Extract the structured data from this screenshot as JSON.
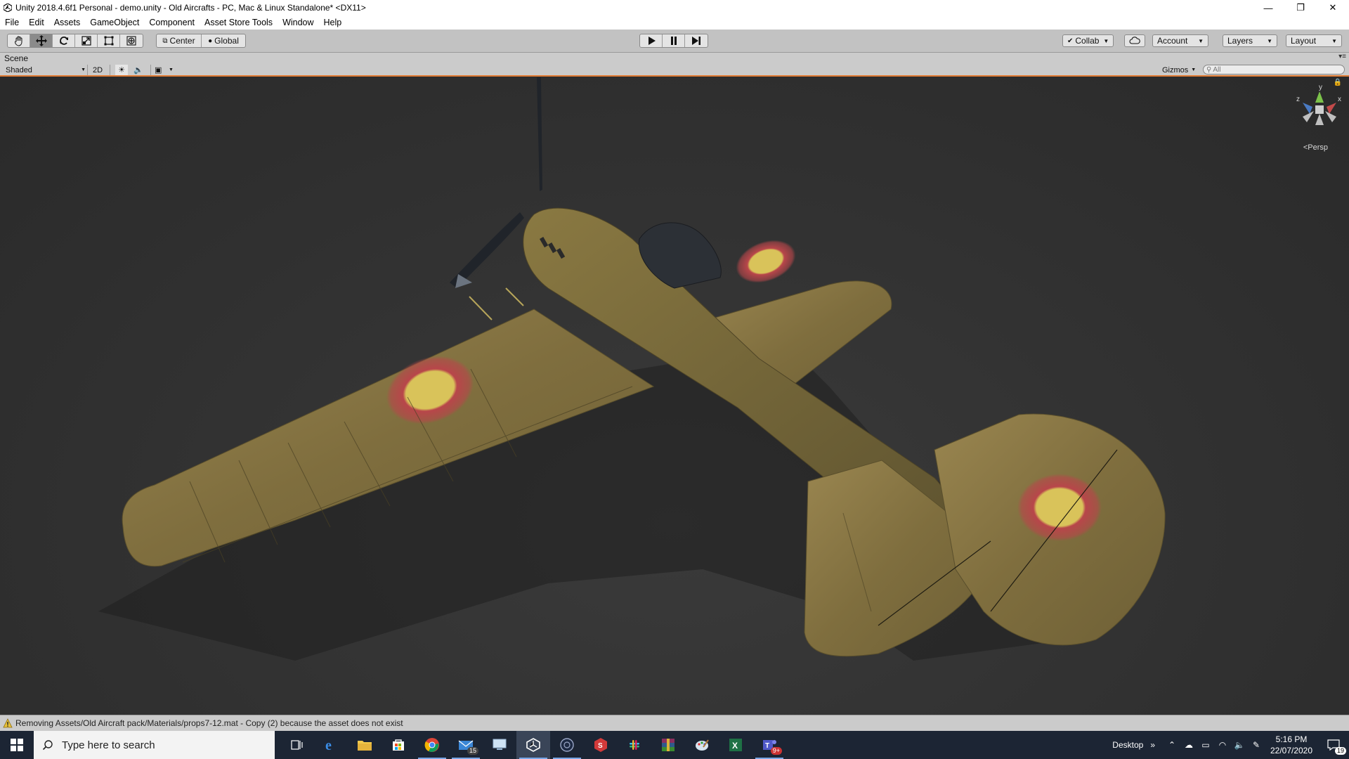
{
  "window": {
    "title": "Unity 2018.4.6f1 Personal - demo.unity - Old Aircrafts - PC, Mac & Linux Standalone* <DX11>",
    "minimize": "—",
    "maximize": "❐",
    "close": "✕"
  },
  "menu": {
    "items": [
      "File",
      "Edit",
      "Assets",
      "GameObject",
      "Component",
      "Asset Store Tools",
      "Window",
      "Help"
    ]
  },
  "toolbar": {
    "tools": [
      "hand-tool",
      "move-tool",
      "rotate-tool",
      "scale-tool",
      "rect-tool",
      "transform-tool"
    ],
    "active_tool": "move-tool",
    "pivot_label": "Center",
    "space_label": "Global",
    "collab_label": "Collab",
    "account_label": "Account",
    "layers_label": "Layers",
    "layout_label": "Layout"
  },
  "scene": {
    "tab_label": "Scene",
    "shading_mode": "Shaded",
    "mode_2d": "2D",
    "gizmos_label": "Gizmos",
    "search_placeholder": "All",
    "projection_label": "Persp",
    "gizmo_axes": {
      "x": "x",
      "y": "y",
      "z": "z"
    }
  },
  "status": {
    "message": "Removing Assets/Old Aircraft pack/Materials/props7-12.mat - Copy (2) because the asset does not exist"
  },
  "taskbar": {
    "search_placeholder": "Type here to search",
    "apps": [
      {
        "name": "task-view-icon",
        "badge": ""
      },
      {
        "name": "edge-icon",
        "badge": ""
      },
      {
        "name": "file-explorer-icon",
        "badge": ""
      },
      {
        "name": "store-icon",
        "badge": ""
      },
      {
        "name": "chrome-icon",
        "badge": ""
      },
      {
        "name": "mail-icon",
        "badge": "15"
      },
      {
        "name": "remote-desktop-icon",
        "badge": ""
      },
      {
        "name": "unity-icon",
        "badge": ""
      },
      {
        "name": "cinema4d-icon",
        "badge": ""
      },
      {
        "name": "substance-icon",
        "badge": ""
      },
      {
        "name": "slack-icon",
        "badge": ""
      },
      {
        "name": "winrar-icon",
        "badge": ""
      },
      {
        "name": "paint-icon",
        "badge": ""
      },
      {
        "name": "excel-icon",
        "badge": ""
      },
      {
        "name": "teams-icon",
        "badge": "9+"
      }
    ],
    "desktop_label": "Desktop",
    "chevron": "»",
    "time": "5:16 PM",
    "date": "22/07/2020",
    "notification_count": "19"
  },
  "colors": {
    "accent_orange": "#e07b33",
    "camo_base": "#8c7a45",
    "roundel_red": "#b8464a",
    "roundel_yellow": "#d9c35a"
  }
}
